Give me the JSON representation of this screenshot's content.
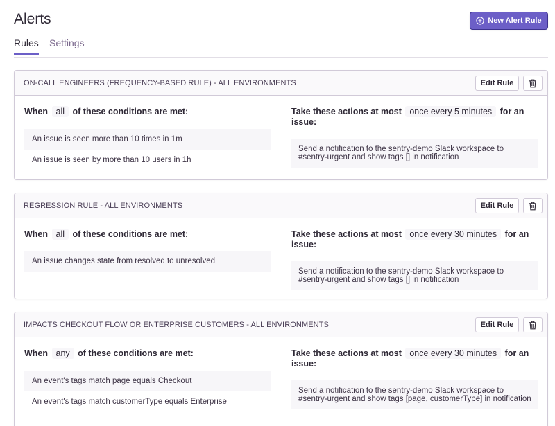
{
  "page": {
    "title": "Alerts",
    "new_rule_label": "New Alert Rule"
  },
  "tabs": [
    {
      "label": "Rules"
    },
    {
      "label": "Settings"
    }
  ],
  "common": {
    "edit_label": "Edit Rule",
    "when_prefix": "When",
    "when_suffix": "of these conditions are met:",
    "actions_prefix": "Take these actions at most",
    "actions_suffix": "for an issue:"
  },
  "rules": [
    {
      "title": "On-Call Engineers (Frequency-based rule) - All Environments",
      "match": "all",
      "frequency": "once every 5 minutes",
      "conditions": [
        "An issue is seen more than 10 times in 1m",
        "An issue is seen by more than 10 users in 1h"
      ],
      "action": "Send a notification to the sentry-demo Slack workspace to #sentry-urgent and show tags [] in notification"
    },
    {
      "title": "Regression Rule - All Environments",
      "match": "all",
      "frequency": "once every 30 minutes",
      "conditions": [
        "An issue changes state from resolved to unresolved"
      ],
      "action": "Send a notification to the sentry-demo Slack workspace to #sentry-urgent and show tags [] in notification"
    },
    {
      "title": "Impacts Checkout Flow or Enterprise Customers - All Environments",
      "match": "any",
      "frequency": "once every 30 minutes",
      "conditions": [
        "An event's tags match page equals Checkout",
        "An event's tags match customerType equals Enterprise"
      ],
      "action": "Send a notification to the sentry-demo Slack workspace to #sentry-urgent and show tags [page, customerType] in notification"
    }
  ],
  "icons": {
    "new_rule": "plus-circle-icon",
    "delete": "trash-icon"
  },
  "colors": {
    "accent": "#6c5fc7",
    "border": "#d1cad8",
    "header_bg": "#faf9fb",
    "item_bg": "#f7f6f9"
  }
}
